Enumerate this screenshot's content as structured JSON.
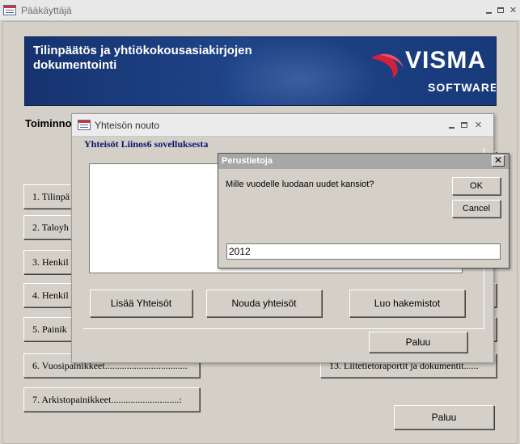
{
  "main_window": {
    "title": "Pääkäyttäjä",
    "banner_title": "Tilinpäätös ja yhtiökokousasiakirjojen dokumentointi",
    "logo_text": "VISMA",
    "logo_subtext": "SOFTWARE",
    "logo_registered": "®",
    "section_label": "Toiminno",
    "menu_buttons": [
      "1. Tilinpä",
      "2. Taloyh",
      "3.  Henkil",
      "4.  Henkil",
      "5. Painik",
      "6. Vuosipainikkeet..................................",
      "7. Arkistopainikkeet............................:"
    ],
    "right_partial_button": "13. Liitetietoraportit ja dokumentit......",
    "back_label": "Paluu"
  },
  "dialog_nouto": {
    "title": "Yhteisön nouto",
    "heading": "Yhteisöt Liinos6 sovelluksesta",
    "buttons": {
      "add": "Lisää Yhteisöt",
      "fetch": "Nouda yhteisöt",
      "create_dirs": "Luo hakemistot",
      "back": "Paluu"
    }
  },
  "dialog_perustietoja": {
    "title": "Perustietoja",
    "question": "Mille vuodelle luodaan uudet kansiot?",
    "ok_label": "OK",
    "cancel_label": "Cancel",
    "year_value": "2012",
    "close_glyph": "✕"
  },
  "colors": {
    "banner_blue": "#1f4488",
    "heading_navy": "#0c1470",
    "window_face": "#d4d0c8",
    "logo_red": "#d6203a"
  }
}
